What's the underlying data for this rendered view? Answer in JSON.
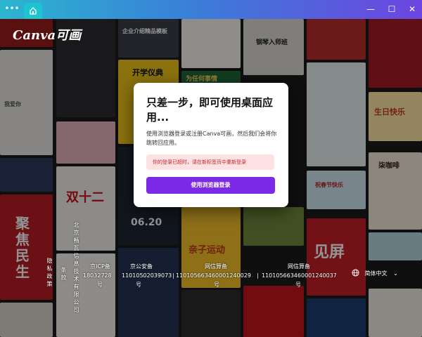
{
  "titlebar": {
    "more_icon": "ellipsis-icon",
    "home_icon": "home-icon",
    "minimize": "—",
    "maximize": "☐",
    "close": "✕"
  },
  "logo": "Canva可画",
  "modal": {
    "title": "只差一步，即可使用桌面应用...",
    "description": "使用浏览器登录或注册Canva可画，然后我们会将你跳转回应用。",
    "alert": "你的登录已超时，请在新标签页中重新登录",
    "button": "使用浏览器登录"
  },
  "footer": {
    "privacy": "隐私政策",
    "terms": "条款",
    "company": "北京畅瓦信息技术有限公司",
    "icp_label": "京ICP备",
    "icp_number": "18032728",
    "icp_suffix": "号",
    "police_label": "京公安备",
    "police_number": "11010502039073",
    "police_suffix": "号",
    "net1_label": "网信算备",
    "net1_number": "110105663460001240029",
    "net1_suffix": "号",
    "net2_label": "网信算备",
    "net2_number": "110105663460001240037",
    "net2_suffix": "号",
    "language": "简体中文"
  },
  "tiles": {
    "t1": "企业介绍精品模板",
    "t2": "开学仪典",
    "t3": "为任何事情",
    "t4": "钢琴入师班",
    "t5": "我爱你",
    "t6": "生日快乐",
    "t7": "柒咖啡",
    "t8": "双十二",
    "t9": "06.20",
    "t10": "聚焦民生",
    "t11": "见屏",
    "t12": "亲子运动",
    "t13": "祝春节快乐"
  }
}
